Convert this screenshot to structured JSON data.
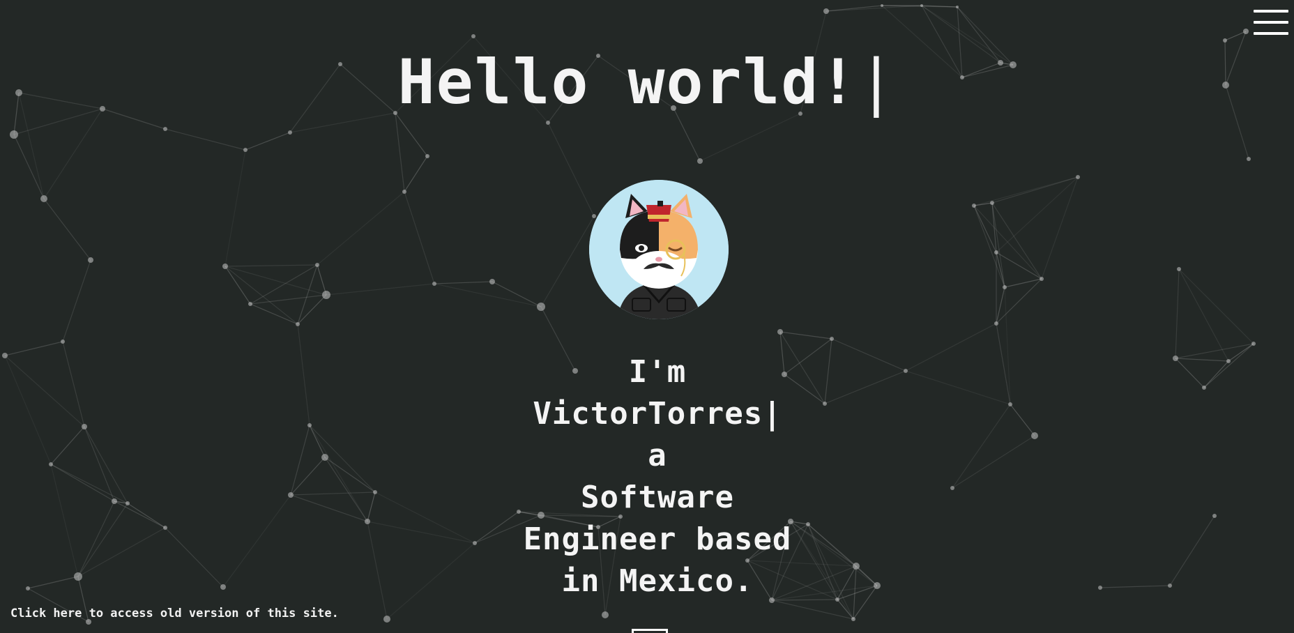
{
  "header": {
    "title": "Hello world!",
    "cursor": "|",
    "menu_icon": "hamburger-menu-icon"
  },
  "profile": {
    "avatar_icon": "cat-avatar-illustration",
    "avatar_background": "#bfe6f3"
  },
  "intro": {
    "line1": "I'm",
    "line2": "VictorTorres|",
    "line3": "a",
    "line4": "Software",
    "line5": "Engineer based",
    "line6": "in Mexico."
  },
  "footer": {
    "old_version_link": "Click here to access old version of this site."
  },
  "theme": {
    "background": "#232826",
    "text": "#f4f4f4",
    "network": "#c8c8c8"
  }
}
